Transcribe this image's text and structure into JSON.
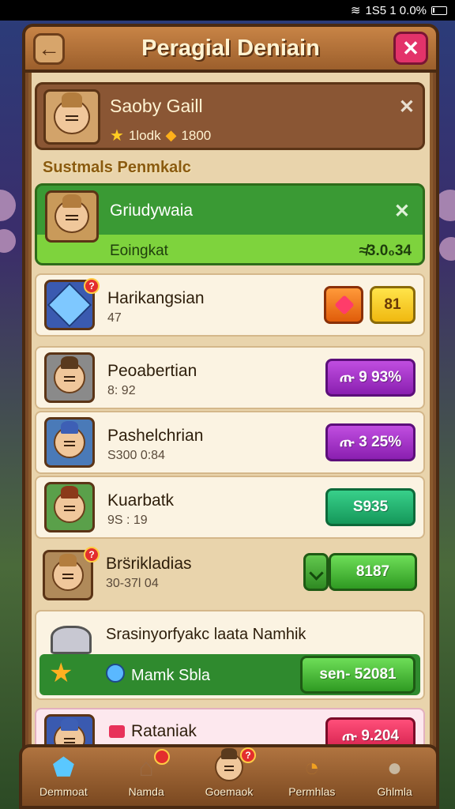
{
  "status_bar": {
    "time_text": "1S5 1 0.0%"
  },
  "header": {
    "title": "Peragial Deniain"
  },
  "profile": {
    "name": "Saoby Gaill",
    "stat1": "1lodk",
    "stat2": "1800"
  },
  "section_title": "Sustmals Penmkalc",
  "featured": {
    "title": "Griudywaia",
    "sub_label": "Eoingkat",
    "price": "≉3.0₀34"
  },
  "rows": [
    {
      "name": "Harikangsian",
      "sub": "47",
      "button": "81"
    },
    {
      "name": "Peoabertian",
      "sub": "8: 92",
      "price": "ጡ 9 93%"
    },
    {
      "name": "Pashelchrian",
      "sub": "S300 0:84",
      "price": "ጡ 3 25%"
    },
    {
      "name": "Kuarbatk",
      "sub": "9S : 19",
      "price": "S935"
    },
    {
      "name": "Brs̈rikladias",
      "sub": "30-37l 04",
      "price": "8187"
    }
  ],
  "promo": {
    "title": "Srasinyorfyakc laata Namhik",
    "bar_label": "Mamk Sbla",
    "bar_price": "sen- 52081"
  },
  "partial_row": {
    "name": "Rataniak",
    "price": "ጡ 9.204"
  },
  "nav": [
    {
      "label": "Demmoat"
    },
    {
      "label": "Namda"
    },
    {
      "label": "Goemaok"
    },
    {
      "label": "Permhlas"
    },
    {
      "label": "Ghlmla"
    }
  ],
  "colors": {
    "accent_green": "#2f8a2e",
    "accent_purple": "#8a1fb0",
    "accent_red": "#d01c48",
    "wood": "#7a4a26"
  }
}
